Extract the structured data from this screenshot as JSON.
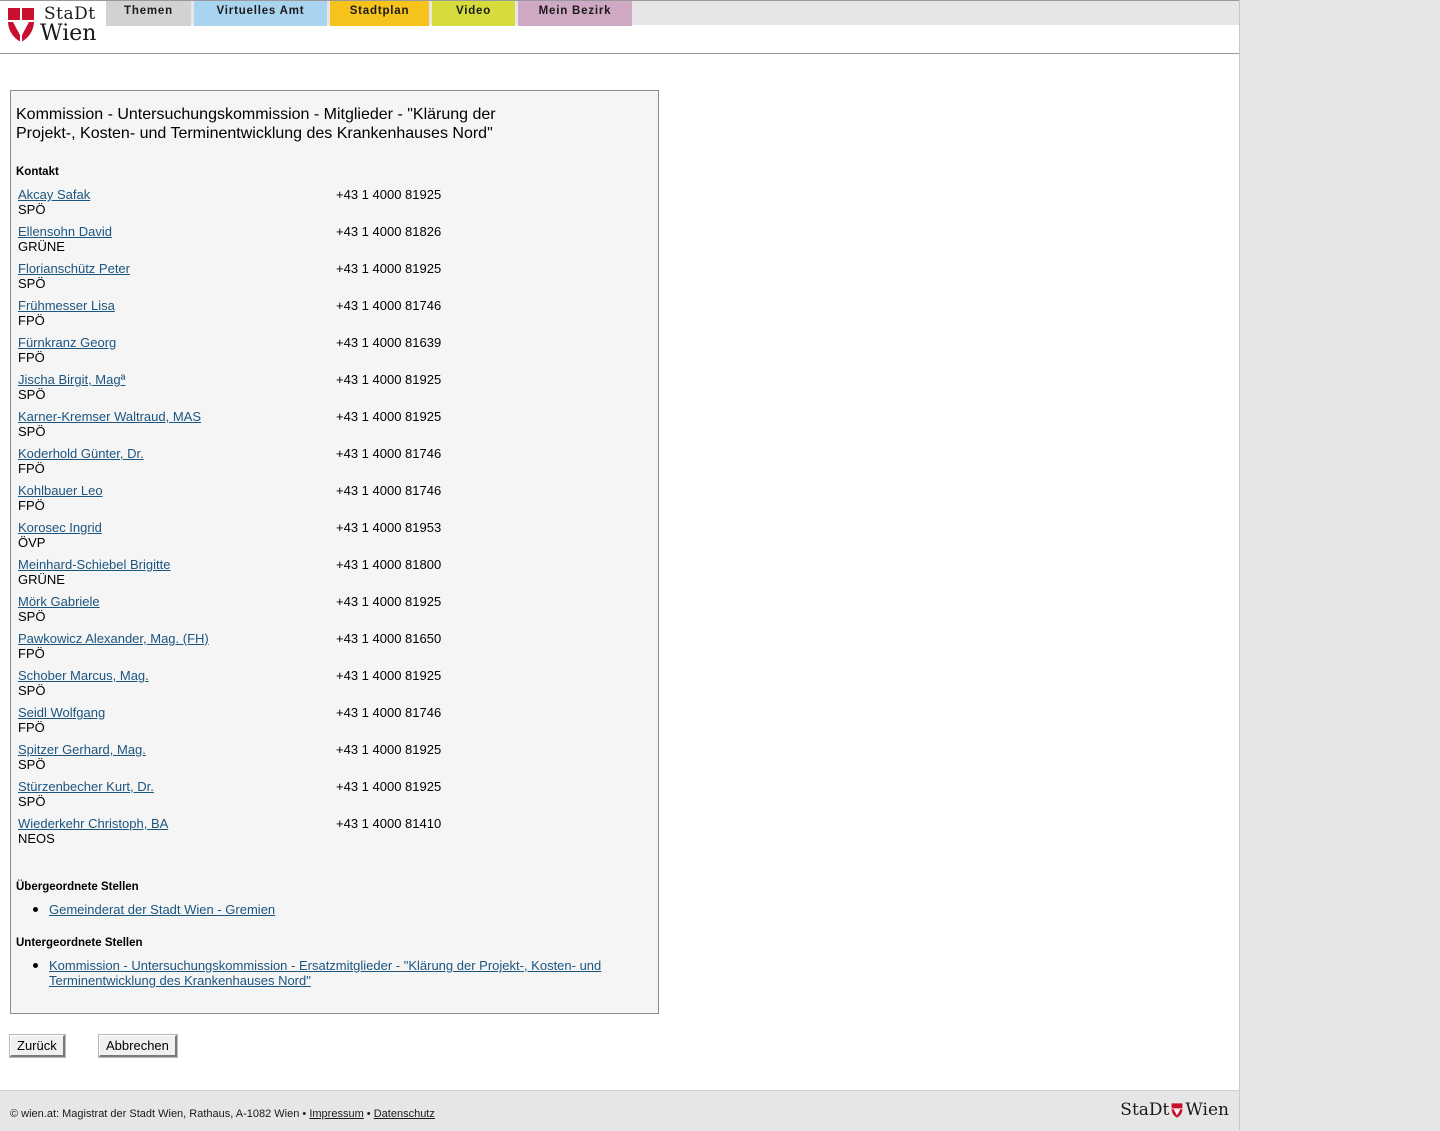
{
  "header": {
    "logo_stadt": "StaDt",
    "logo_wien": "Wien",
    "nav": [
      {
        "label": "Themen",
        "color": "#d2d2d2"
      },
      {
        "label": "Virtuelles Amt",
        "color": "#a9d4f0"
      },
      {
        "label": "Stadtplan",
        "color": "#f5c31c"
      },
      {
        "label": "Video",
        "color": "#d6dc3c"
      },
      {
        "label": "Mein Bezirk",
        "color": "#cfa9c4"
      }
    ]
  },
  "main": {
    "title": "Kommission - Untersuchungskommission - Mitglieder - \"Klärung der Projekt-, Kosten- und Terminentwicklung des Krankenhauses Nord\"",
    "contact_heading": "Kontakt",
    "contacts": [
      {
        "name": "Akcay Safak",
        "party": "SPÖ",
        "phone": "+43 1 4000 81925"
      },
      {
        "name": "Ellensohn David",
        "party": "GRÜNE",
        "phone": "+43 1 4000 81826"
      },
      {
        "name": "Florianschütz Peter",
        "party": "SPÖ",
        "phone": "+43 1 4000 81925"
      },
      {
        "name": "Frühmesser Lisa",
        "party": "FPÖ",
        "phone": "+43 1 4000 81746"
      },
      {
        "name": "Fürnkranz Georg",
        "party": "FPÖ",
        "phone": "+43 1 4000 81639"
      },
      {
        "name": "Jischa Birgit, Magª",
        "party": "SPÖ",
        "phone": "+43 1 4000 81925"
      },
      {
        "name": "Karner-Kremser Waltraud, MAS",
        "party": "SPÖ",
        "phone": "+43 1 4000 81925"
      },
      {
        "name": "Koderhold Günter, Dr.",
        "party": "FPÖ",
        "phone": "+43 1 4000 81746"
      },
      {
        "name": "Kohlbauer Leo",
        "party": "FPÖ",
        "phone": "+43 1 4000 81746"
      },
      {
        "name": "Korosec Ingrid",
        "party": "ÖVP",
        "phone": "+43 1 4000 81953"
      },
      {
        "name": "Meinhard-Schiebel Brigitte",
        "party": "GRÜNE",
        "phone": "+43 1 4000 81800"
      },
      {
        "name": "Mörk Gabriele",
        "party": "SPÖ",
        "phone": "+43 1 4000 81925"
      },
      {
        "name": "Pawkowicz Alexander, Mag. (FH)",
        "party": "FPÖ",
        "phone": "+43 1 4000 81650"
      },
      {
        "name": "Schober Marcus, Mag.",
        "party": "SPÖ",
        "phone": "+43 1 4000 81925"
      },
      {
        "name": "Seidl Wolfgang",
        "party": "FPÖ",
        "phone": "+43 1 4000 81746"
      },
      {
        "name": "Spitzer Gerhard, Mag.",
        "party": "SPÖ",
        "phone": "+43 1 4000 81925"
      },
      {
        "name": "Stürzenbecher Kurt, Dr.",
        "party": "SPÖ",
        "phone": "+43 1 4000 81925"
      },
      {
        "name": "Wiederkehr Christoph, BA",
        "party": "NEOS",
        "phone": "+43 1 4000 81410"
      }
    ],
    "parent_heading": "Übergeordnete Stellen",
    "parent_links": [
      "Gemeinderat der Stadt Wien - Gremien"
    ],
    "child_heading": "Untergeordnete Stellen",
    "child_links": [
      "Kommission - Untersuchungskommission - Ersatzmitglieder - \"Klärung der Projekt-, Kosten- und Terminentwicklung des Krankenhauses Nord\""
    ]
  },
  "buttons": {
    "back": "Zurück",
    "cancel": "Abbrechen"
  },
  "footer": {
    "text": "© wien.at: Magistrat der Stadt Wien, Rathaus, A-1082 Wien •",
    "separator": "•",
    "impressum": "Impressum",
    "datenschutz": "Datenschutz",
    "logo_stadt": "StaDt",
    "logo_wien": "Wien"
  },
  "colors": {
    "link": "#1c5580",
    "shield_red": "#c8102e"
  }
}
